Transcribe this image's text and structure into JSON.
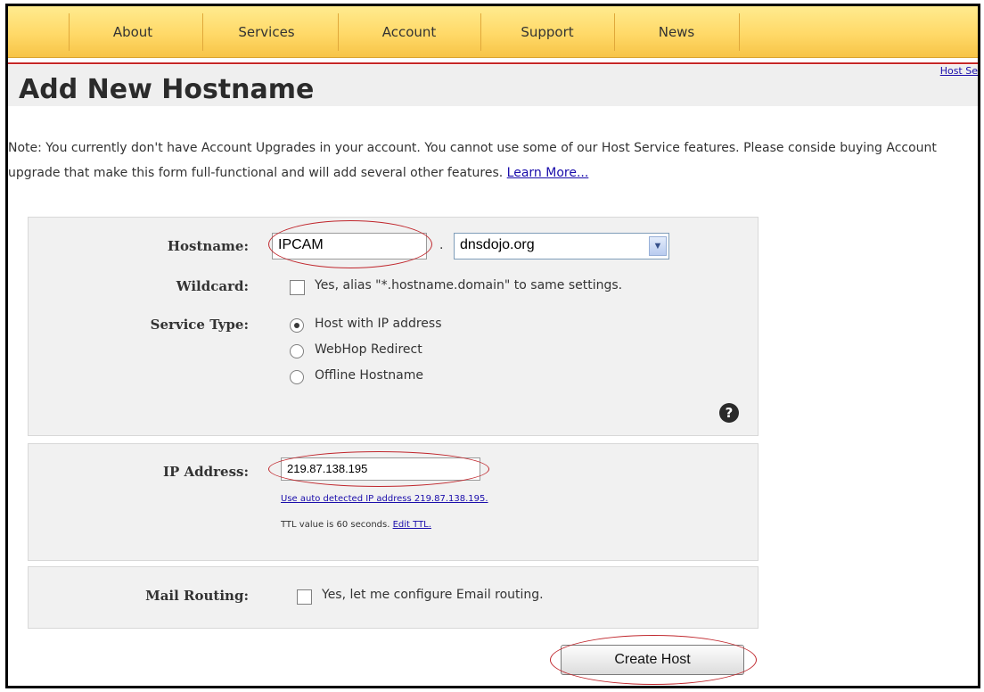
{
  "nav": {
    "items": [
      "About",
      "Services",
      "Account",
      "Support",
      "News"
    ]
  },
  "header": {
    "title": "Add New Hostname",
    "corner_link": "Host Se"
  },
  "note": {
    "text": "Note: You currently don't have Account Upgrades in your account. You cannot use some of our Host Service features. Please conside buying Account upgrade that make this form full-functional and will add several other features. ",
    "link": "Learn More..."
  },
  "form": {
    "hostname": {
      "label": "Hostname:",
      "value": "IPCAM",
      "dot": ".",
      "domain_selected": "dnsdojo.org"
    },
    "wildcard": {
      "label": "Wildcard:",
      "checkbox_label": "Yes, alias \"*.hostname.domain\" to same settings."
    },
    "service_type": {
      "label": "Service Type:",
      "options": [
        "Host with IP address",
        "WebHop Redirect",
        "Offline Hostname"
      ],
      "selected_index": 0
    },
    "help_icon": "question-mark-icon",
    "ip": {
      "label": "IP Address:",
      "value": "219.87.138.195",
      "auto_link": "Use auto detected IP address 219.87.138.195.",
      "ttl_text": "TTL value is 60 seconds. ",
      "ttl_link": "Edit TTL."
    },
    "mail": {
      "label": "Mail Routing:",
      "checkbox_label": "Yes, let me configure Email routing."
    },
    "submit_label": "Create Host"
  },
  "colors": {
    "nav_bg": "#ffd968",
    "accent_red": "#c62828",
    "link": "#1a0dab",
    "panel_bg": "#f1f1f1",
    "annotation_ellipse": "#c0272d"
  }
}
